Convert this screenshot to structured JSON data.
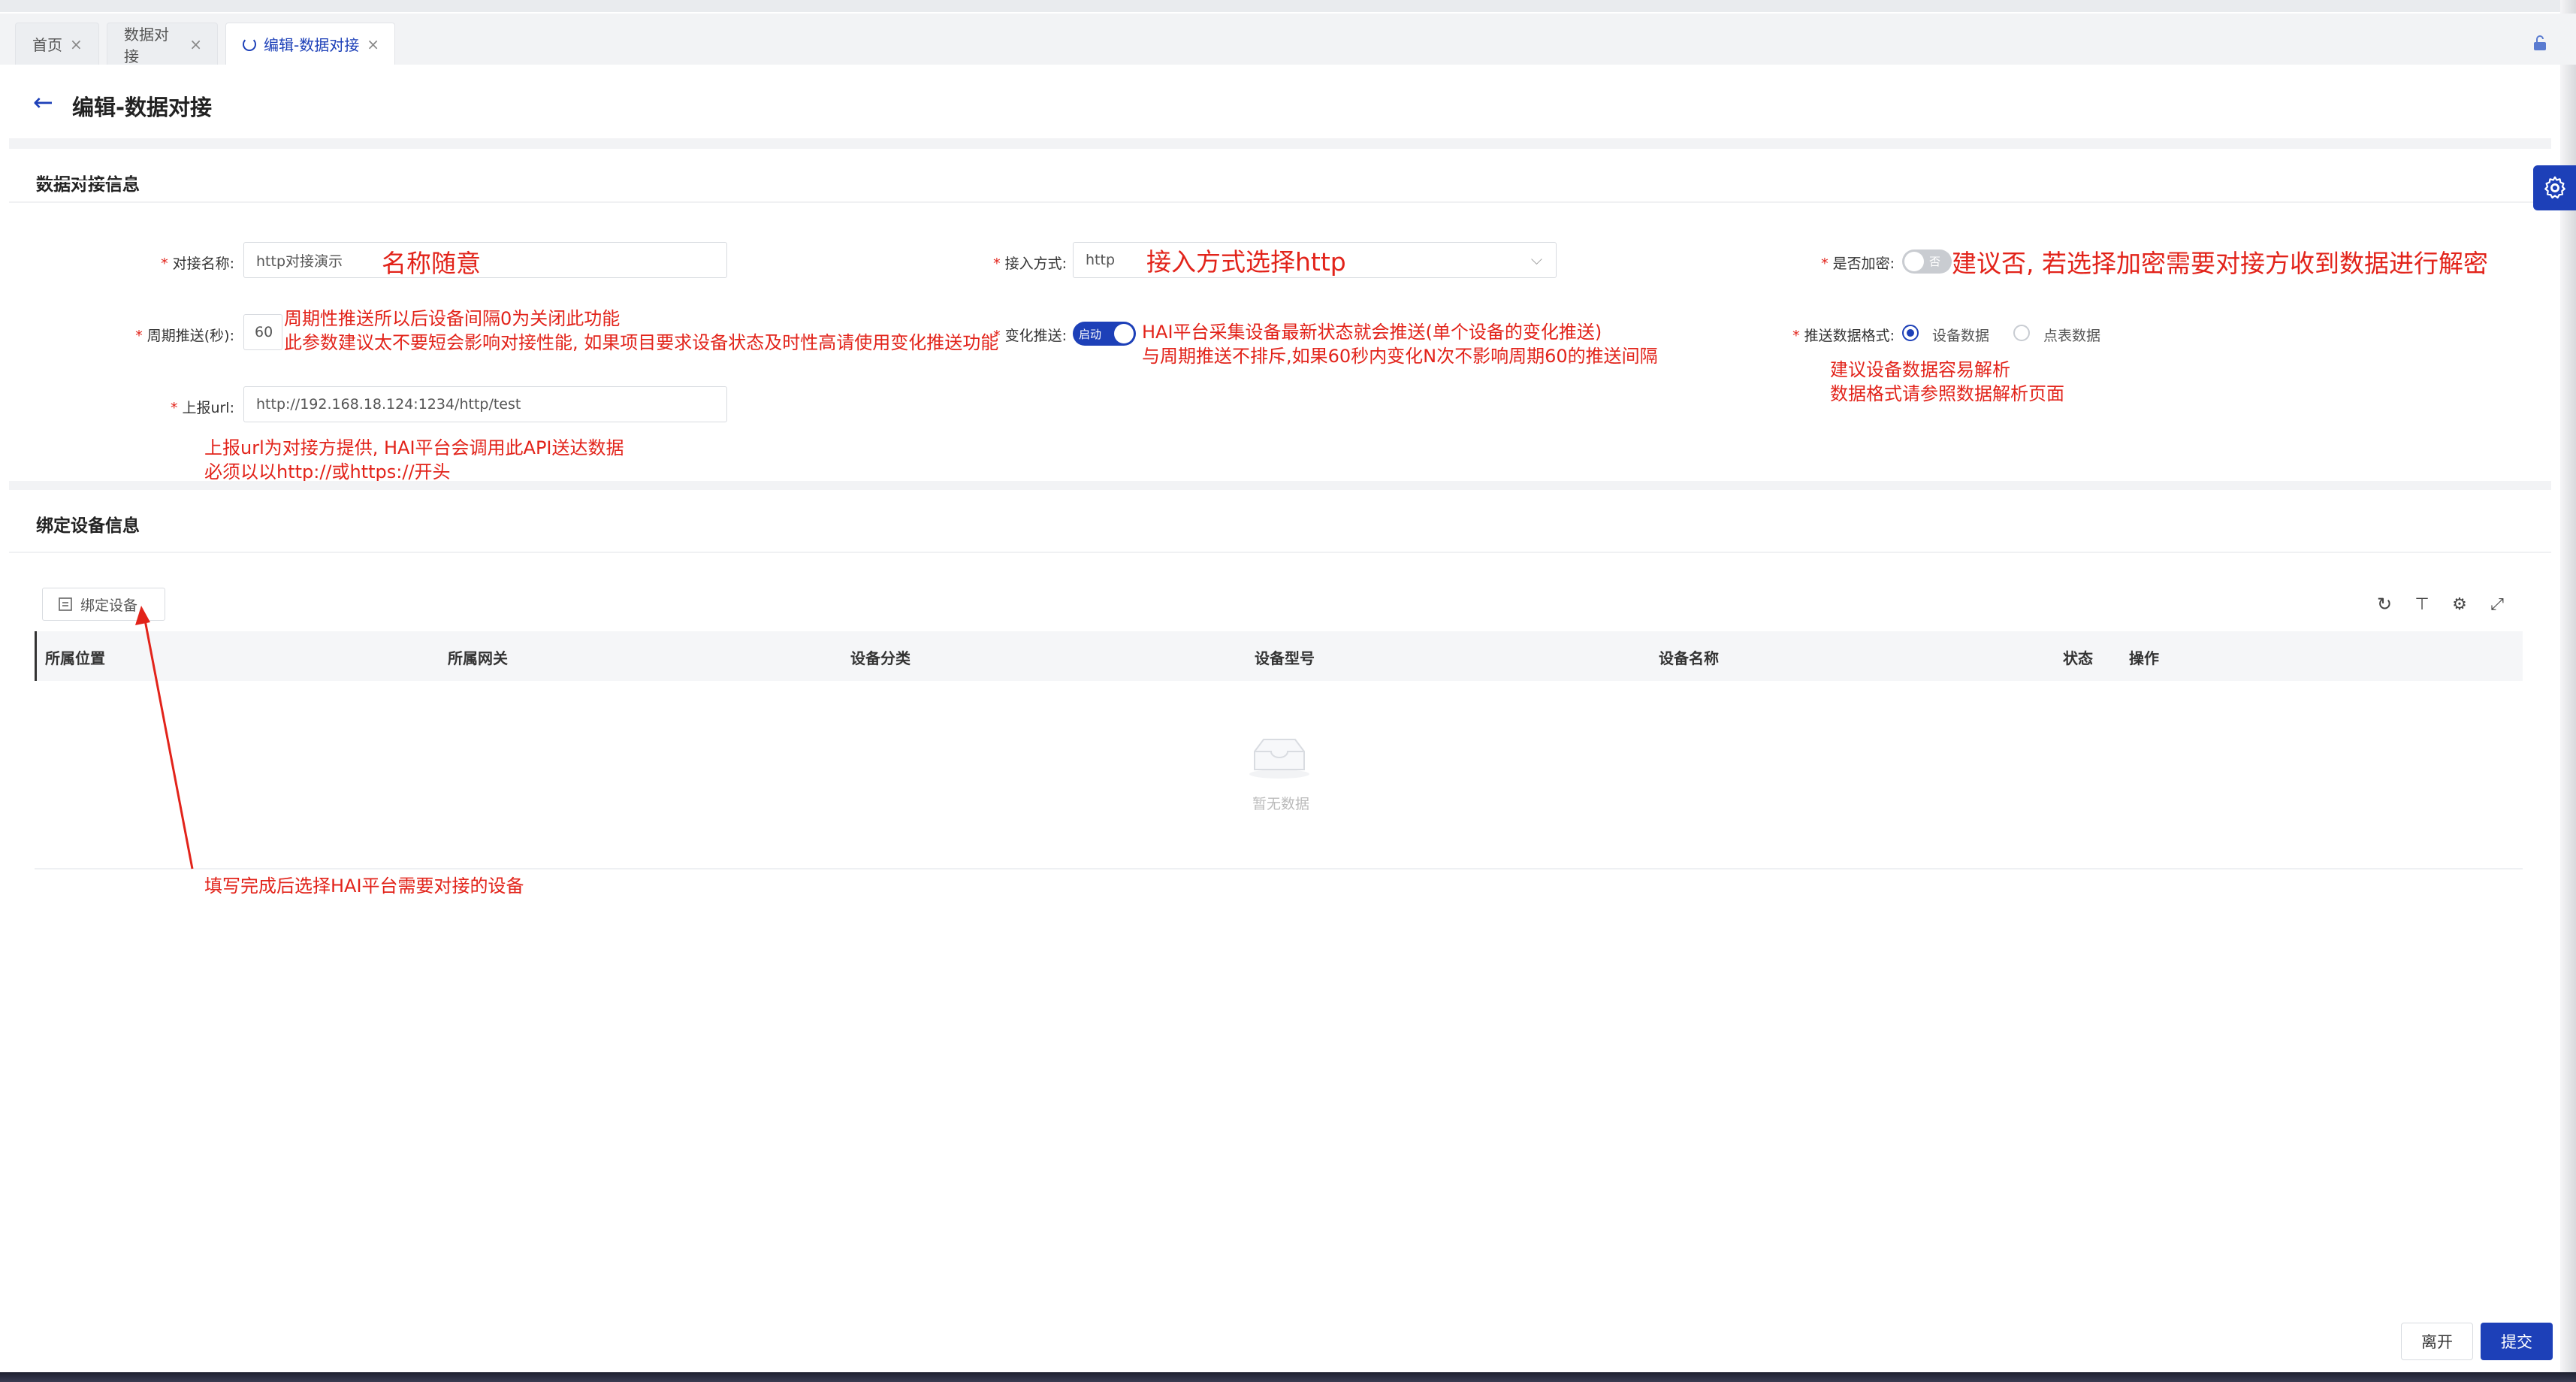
{
  "tabs": [
    {
      "label": "首页",
      "active": false
    },
    {
      "label": "数据对接",
      "active": false
    },
    {
      "label": "编辑-数据对接",
      "active": true
    }
  ],
  "page": {
    "title": "编辑-数据对接"
  },
  "section_info": {
    "title": "数据对接信息",
    "fields": {
      "name": {
        "label": "对接名称:",
        "value": "http对接演示"
      },
      "access_mode": {
        "label": "接入方式:",
        "value": "http"
      },
      "encrypt": {
        "label": "是否加密:",
        "toggle_text": "否",
        "on": false
      },
      "period": {
        "label": "周期推送(秒):",
        "value": "60"
      },
      "change_push": {
        "label": "变化推送:",
        "toggle_text": "启动",
        "on": true
      },
      "push_format": {
        "label": "推送数据格式:",
        "options": [
          "设备数据",
          "点表数据"
        ],
        "selected": "设备数据"
      },
      "report_url": {
        "label": "上报url:",
        "value": "http://192.168.18.124:1234/http/test"
      }
    }
  },
  "annotations": {
    "name_hint": "名称随意",
    "access_hint": "接入方式选择http",
    "encrypt_hint": "建议否, 若选择加密需要对接方收到数据进行解密",
    "period_hint_1": "周期性推送所以后设备间隔0为关闭此功能",
    "period_hint_2": "此参数建议太不要短会影响对接性能, 如果项目要求设备状态及时性高请使用变化推送功能",
    "change_hint_1": "HAI平台采集设备最新状态就会推送(单个设备的变化推送)",
    "change_hint_2": "与周期推送不排斥,如果60秒内变化N次不影响周期60的推送间隔",
    "format_hint_1": "建议设备数据容易解析",
    "format_hint_2": "数据格式请参照数据解析页面",
    "url_hint_1": "上报url为对接方提供, HAI平台会调用此API送达数据",
    "url_hint_2": "必须以以http://或https://开头",
    "bind_hint": "填写完成后选择HAI平台需要对接的设备"
  },
  "section_bind": {
    "title": "绑定设备信息",
    "bind_button": "绑定设备",
    "columns": [
      "所属位置",
      "所属网关",
      "设备分类",
      "设备型号",
      "设备名称",
      "状态",
      "操作"
    ],
    "empty_text": "暂无数据"
  },
  "footer": {
    "leave": "离开",
    "submit": "提交"
  },
  "colors": {
    "primary": "#1d40b8",
    "annotation": "#e2231a"
  }
}
